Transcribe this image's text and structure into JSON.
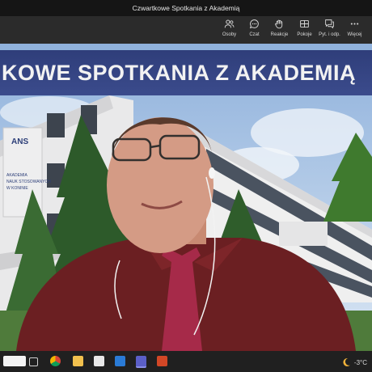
{
  "window": {
    "title": "Czwartkowe Spotkania z Akademią"
  },
  "toolbar": {
    "items": [
      {
        "label": "Osoby",
        "icon": "people-icon"
      },
      {
        "label": "Czat",
        "icon": "chat-icon"
      },
      {
        "label": "Reakcje",
        "icon": "reactions-icon"
      },
      {
        "label": "Pokoje",
        "icon": "rooms-icon"
      },
      {
        "label": "Pyt. i odp.",
        "icon": "qa-icon"
      },
      {
        "label": "Więcej",
        "icon": "more-icon"
      }
    ]
  },
  "video": {
    "banner_text": "KOWE SPOTKANIA Z AKADEMIĄ",
    "building_logo": "ANS",
    "building_sign": [
      "AKADEMIA",
      "NAUK STOSOWANYCH",
      "W KONINIE"
    ]
  },
  "taskbar": {
    "apps": [
      "search-icon",
      "task-view-icon",
      "chrome-icon",
      "file-explorer-icon",
      "store-icon",
      "mail-icon",
      "teams-icon",
      "powerpoint-icon"
    ],
    "weather": {
      "icon": "moon-icon",
      "temperature": "-3°C"
    }
  },
  "colors": {
    "banner": "#344484",
    "titlebar": "#151515",
    "toolbar": "#2b2b2b",
    "taskbar": "#202020"
  }
}
